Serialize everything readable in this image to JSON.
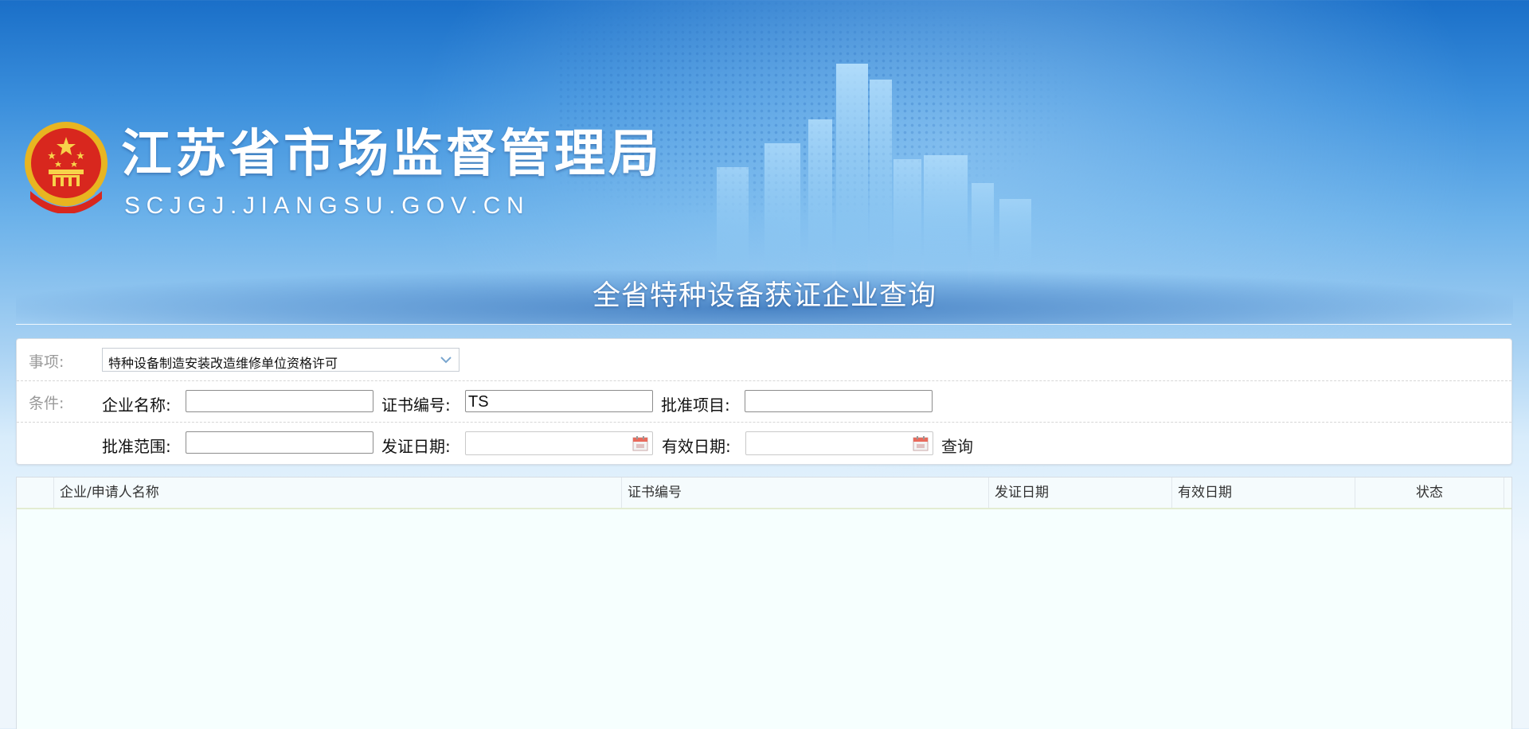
{
  "header": {
    "site_name": "江苏省市场监督管理局",
    "site_domain": "SCJGJ.JIANGSU.GOV.CN",
    "emblem_icon": "national-emblem-icon",
    "page_title": "全省特种设备获证企业查询"
  },
  "search": {
    "matter_label": "事项:",
    "matter_selected": "特种设备制造安装改造维修单位资格许可",
    "condition_label": "条件:",
    "company_name_label": "企业名称:",
    "company_name_value": "",
    "cert_no_label": "证书编号:",
    "cert_no_value": "TS",
    "approved_item_label": "批准项目:",
    "approved_item_value": "",
    "approved_scope_label": "批准范围:",
    "approved_scope_value": "",
    "issue_date_label": "发证日期:",
    "issue_date_value": "",
    "valid_date_label": "有效日期:",
    "valid_date_value": "",
    "query_label": "查询"
  },
  "grid": {
    "columns": [
      "",
      "企业/申请人名称",
      "证书编号",
      "发证日期",
      "有效日期",
      "状态"
    ],
    "rows": []
  },
  "colors": {
    "banner_top": "#1a6fc8",
    "banner_bottom": "#eef6fc",
    "panel_bg": "#ffffff",
    "grid_bg": "#f7fffe"
  }
}
